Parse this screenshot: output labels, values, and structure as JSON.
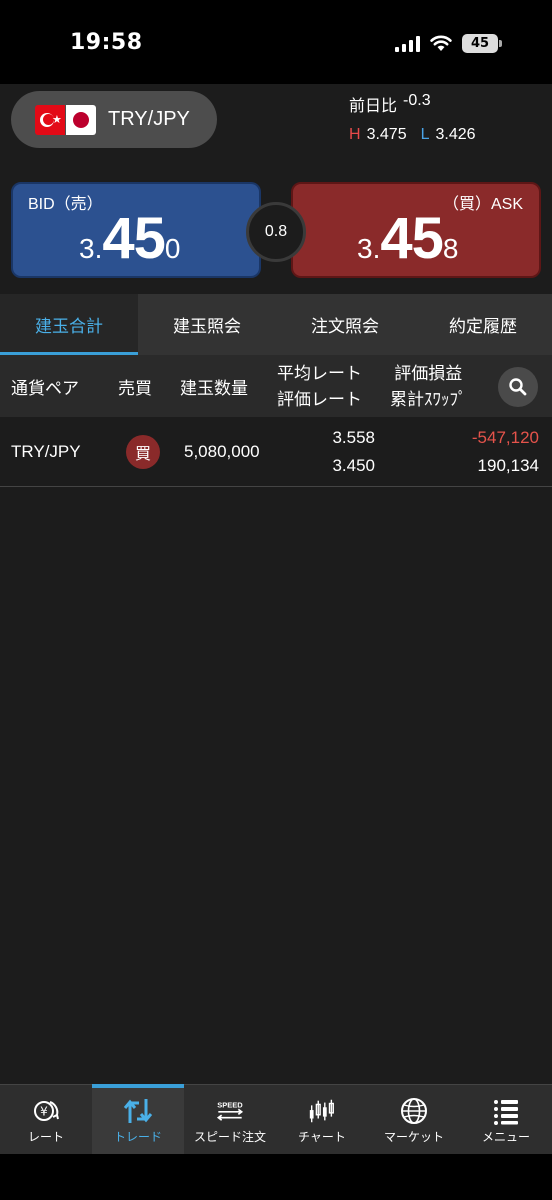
{
  "status_bar": {
    "time": "19:58",
    "battery": "45"
  },
  "pair": {
    "name": "TRY/JPY"
  },
  "change": {
    "label": "前日比",
    "value": "-0.3"
  },
  "high_low": {
    "h_label": "H",
    "h_value": "3.475",
    "l_label": "L",
    "l_value": "3.426"
  },
  "bid": {
    "label": "BID（売）",
    "prefix": "3.",
    "big": "45",
    "small": "0"
  },
  "ask": {
    "label": "（買）ASK",
    "prefix": "3.",
    "big": "45",
    "small": "8"
  },
  "spread": "0.8",
  "tabs": [
    {
      "label": "建玉合計"
    },
    {
      "label": "建玉照会"
    },
    {
      "label": "注文照会"
    },
    {
      "label": "約定履歴"
    }
  ],
  "table": {
    "headers": {
      "pair": "通貨ペア",
      "side": "売買",
      "quantity": "建玉数量",
      "avg_rate": "平均レート",
      "eval_rate": "評価レート",
      "eval_pl": "評価損益",
      "swap": "累計ｽﾜｯﾌﾟ"
    },
    "rows": [
      {
        "pair": "TRY/JPY",
        "side": "買",
        "quantity": "5,080,000",
        "avg_rate": "3.558",
        "eval_rate": "3.450",
        "eval_pl": "-547,120",
        "swap": "190,134"
      }
    ]
  },
  "nav": [
    {
      "label": "レート"
    },
    {
      "label": "トレード"
    },
    {
      "label": "スピード注文"
    },
    {
      "label": "チャート"
    },
    {
      "label": "マーケット"
    },
    {
      "label": "メニュー"
    }
  ],
  "icons": {
    "speed_text": "SPEED"
  },
  "colors": {
    "bid": "#2c5190",
    "ask": "#8a2a2a",
    "accent": "#4ab0e8",
    "negative": "#e5534b"
  }
}
